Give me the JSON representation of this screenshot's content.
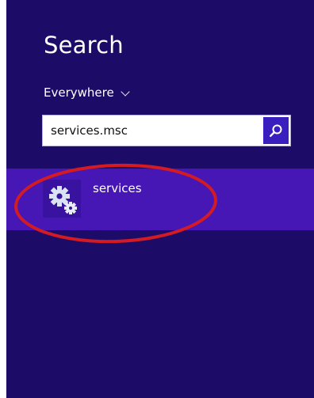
{
  "search": {
    "title": "Search",
    "scope_label": "Everywhere",
    "query": "services.msc",
    "button_icon": "magnifier-icon"
  },
  "results": [
    {
      "label": "services",
      "icon": "gears-icon"
    }
  ],
  "colors": {
    "panel_bg": "#1d0c67",
    "result_bg": "#4617b4",
    "button_bg": "#3a1fbe",
    "annotation": "#d41a22"
  }
}
